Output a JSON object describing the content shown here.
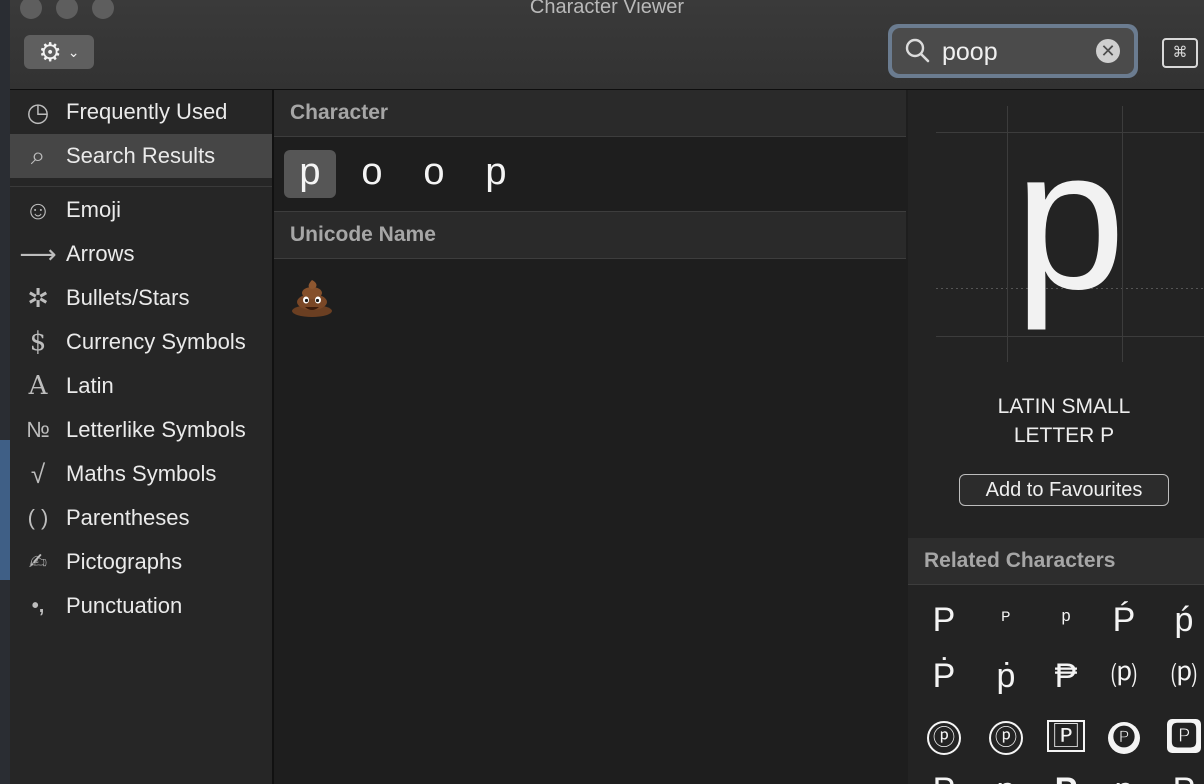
{
  "window": {
    "title": "Character Viewer"
  },
  "toolbar": {
    "gear_icon": "⚙",
    "chevron_icon": "⌄",
    "search_value": "poop",
    "clear_icon": "✕",
    "keyboard_icon": "⌘"
  },
  "sidebar": {
    "items": [
      {
        "icon": "◷",
        "label": "Frequently Used"
      },
      {
        "icon": "⌕",
        "label": "Search Results"
      },
      {
        "icon": "☺",
        "label": "Emoji"
      },
      {
        "icon": "⟶",
        "label": "Arrows"
      },
      {
        "icon": "✲",
        "label": "Bullets/Stars"
      },
      {
        "icon": "$",
        "label": "Currency Symbols"
      },
      {
        "icon": "A",
        "label": "Latin"
      },
      {
        "icon": "№",
        "label": "Letterlike Symbols"
      },
      {
        "icon": "√",
        "label": "Maths Symbols"
      },
      {
        "icon": "( )",
        "label": "Parentheses"
      },
      {
        "icon": "✍",
        "label": "Pictographs"
      },
      {
        "icon": "•,",
        "label": "Punctuation"
      }
    ]
  },
  "middle": {
    "character_header": "Character",
    "characters": [
      "p",
      "o",
      "o",
      "p"
    ],
    "unicode_header": "Unicode Name"
  },
  "detail": {
    "glyph": "p",
    "name_line1": "LATIN SMALL",
    "name_line2": "LETTER P",
    "add_favourites": "Add to Favourites",
    "related_header": "Related Characters",
    "related": [
      "P",
      "ᴾ",
      "ᵖ",
      "Ṕ",
      "ṕ",
      "Ṗ",
      "ṗ",
      "₱",
      "⒫",
      "⒫",
      "ⓟ",
      "ⓟ",
      "🄿",
      "🅟",
      "🅿",
      "P",
      "p",
      "P",
      "p",
      "P"
    ]
  }
}
